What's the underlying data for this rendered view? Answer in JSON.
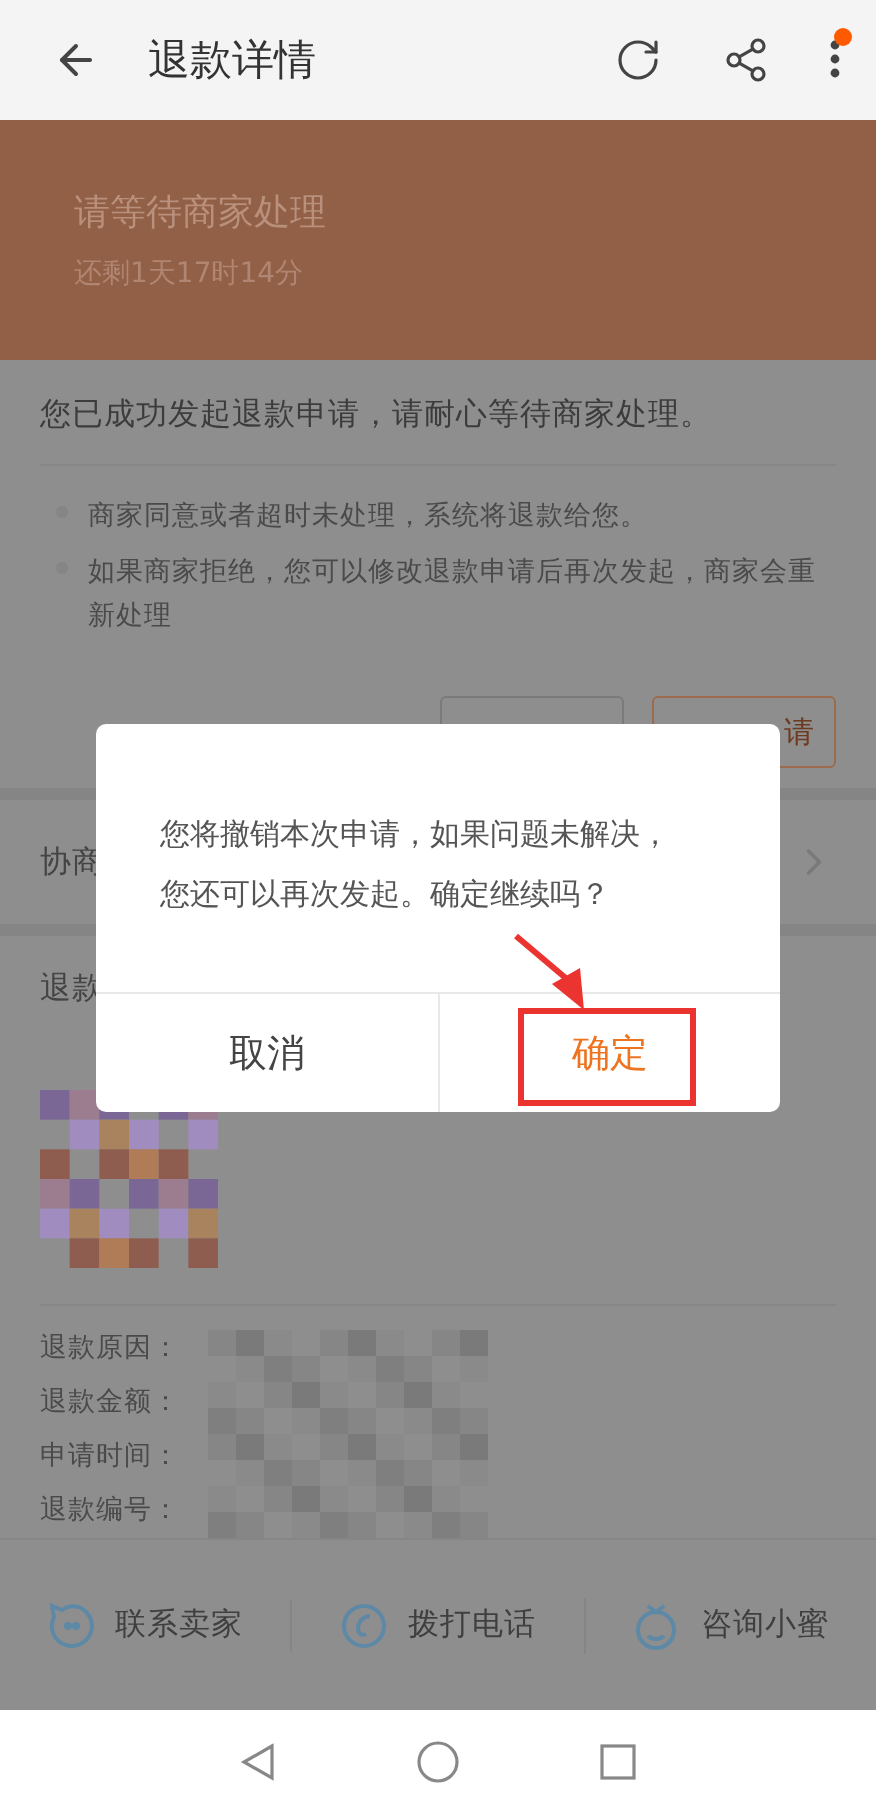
{
  "header": {
    "title": "退款详情",
    "has_badge": true
  },
  "status_banner": {
    "title": "请等待商家处理",
    "subtitle": "还剩1天17时14分"
  },
  "notice": {
    "message": "您已成功发起退款申请，请耐心等待商家处理。",
    "tips": [
      "商家同意或者超时未处理，系统将退款给您。",
      "如果商家拒绝，您可以修改退款申请后再次发起，商家会重新处理"
    ],
    "actions": [
      {
        "kind": "neutral"
      },
      {
        "kind": "accent",
        "label": "请"
      }
    ]
  },
  "negotiation_row": {
    "label": "协商"
  },
  "refund_section": {
    "title": "退款",
    "fields": [
      {
        "label": "退款原因："
      },
      {
        "label": "退款金额："
      },
      {
        "label": "申请时间："
      },
      {
        "label": "退款编号："
      }
    ]
  },
  "contact_bar": [
    {
      "kind": "chat",
      "label": "联系卖家"
    },
    {
      "kind": "phone",
      "label": "拨打电话"
    },
    {
      "kind": "assistant",
      "label": "咨询小蜜"
    }
  ],
  "dialog": {
    "message": "您将撤销本次申请，如果问题未解决，您还可以再次发起。确定继续吗？",
    "buttons": [
      {
        "kind": "cancel",
        "label": "取消"
      },
      {
        "kind": "confirm",
        "label": "确定"
      }
    ]
  }
}
